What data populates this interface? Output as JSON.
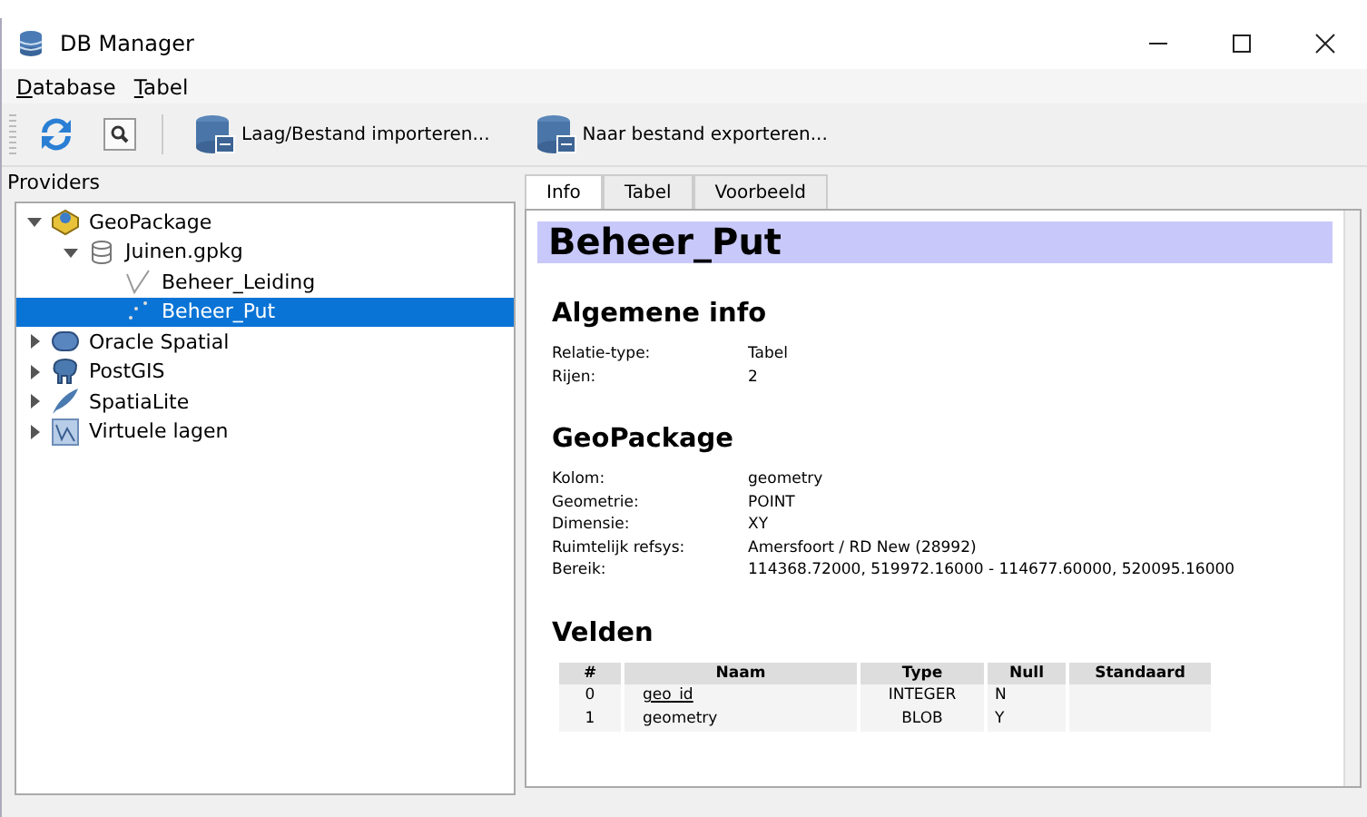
{
  "window": {
    "title": "DB Manager"
  },
  "menu": [
    {
      "label": "Database"
    },
    {
      "label": "Tabel"
    }
  ],
  "toolbar": [
    {
      "kind": "refresh"
    },
    {
      "kind": "sql"
    },
    {
      "kind": "import",
      "label": "Laag/Bestand importeren..."
    },
    {
      "kind": "export",
      "label": "Naar bestand exporteren..."
    }
  ],
  "providers": {
    "title": "Providers",
    "items": [
      {
        "label": "GeoPackage",
        "kind": "geopackage",
        "expanded": true,
        "selected": false,
        "children": [
          {
            "label": "Juinen.gpkg",
            "kind": "db",
            "expanded": true,
            "selected": false,
            "children": [
              {
                "label": "Beheer_Leiding",
                "kind": "line",
                "selected": false
              },
              {
                "label": "Beheer_Put",
                "kind": "point",
                "selected": true
              }
            ]
          }
        ]
      },
      {
        "label": "Oracle Spatial",
        "kind": "oracle",
        "expanded": false,
        "selected": false
      },
      {
        "label": "PostGIS",
        "kind": "postgis",
        "expanded": false,
        "selected": false
      },
      {
        "label": "SpatiaLite",
        "kind": "spatialite",
        "expanded": false,
        "selected": false
      },
      {
        "label": "Virtuele lagen",
        "kind": "virtual",
        "expanded": false,
        "selected": false
      }
    ]
  },
  "tabs": [
    {
      "label": "Info",
      "selected": true
    },
    {
      "label": "Tabel",
      "selected": false
    },
    {
      "label": "Voorbeeld",
      "selected": false
    }
  ],
  "info": {
    "title": "Beheer_Put",
    "sections": [
      {
        "heading": "Algemene info",
        "rows": [
          [
            "Relatie-type:",
            "Tabel"
          ],
          [
            "Rijen:",
            "2"
          ]
        ]
      },
      {
        "heading": "GeoPackage",
        "rows": [
          [
            "Kolom:",
            "geometry"
          ],
          [
            "Geometrie:",
            "POINT"
          ],
          [
            "Dimensie:",
            "XY"
          ],
          [
            "Ruimtelijk refsys:",
            "Amersfoort / RD New (28992)"
          ],
          [
            "Bereik:",
            "114368.72000, 519972.16000 - 114677.60000, 520095.16000"
          ]
        ]
      }
    ],
    "fields_heading": "Velden",
    "fields": {
      "columns": [
        "#",
        "Naam",
        "Type",
        "Null",
        "Standaard"
      ],
      "rows": [
        {
          "num": "0",
          "name": "geo_id",
          "primary": true,
          "type": "INTEGER",
          "null": "N"
        },
        {
          "num": "1",
          "name": "geometry",
          "primary": false,
          "type": "BLOB",
          "null": "Y"
        }
      ]
    }
  }
}
